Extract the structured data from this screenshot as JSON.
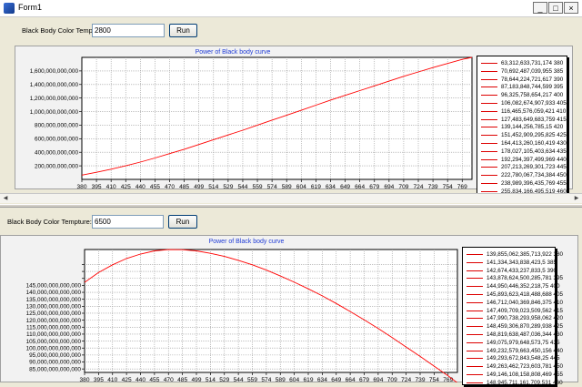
{
  "window": {
    "title": "Form1",
    "min_label": "_",
    "max_label": "□",
    "close_label": "×"
  },
  "icons": {
    "app": "app-icon",
    "minimize": "minimize-icon",
    "maximize": "maximize-icon",
    "close": "close-icon",
    "left": "arrow-left-icon",
    "right": "arrow-right-icon"
  },
  "colors": {
    "curve": "#ff0000",
    "title": "#1f3bd6",
    "grid": "#9a9a9a"
  },
  "panel1": {
    "label": "Black Body Color Tempture:",
    "input_value": "2800",
    "run_label": "Run",
    "chart_title": "Power of Black body curve",
    "legend": [
      "63,312,633,731,174 380",
      "70,692,487,039,955 385",
      "78,644,224,721,617 390",
      "87,183,848,744,599 395",
      "96,325,758,654,217 400",
      "106,082,674,907,933 405",
      "116,465,576,059,421 410",
      "127,483,649,683,759 415",
      "139,144,256,785,15 420",
      "151,452,909,295,825 425",
      "164,413,260,160,419 430",
      "178,027,105,403,634 435",
      "192,294,397,499,969 440",
      "207,213,269,301,723 445",
      "222,780,067,734,384 450",
      "238,989,396,435,769 455",
      "255,834,166,495,519 460"
    ]
  },
  "panel2": {
    "label": "Black Body Color Tempture:",
    "input_value": "6500",
    "run_label": "Run",
    "chart_title": "Power of Black body curve",
    "legend": [
      "139,855,062,385,713,922 380",
      "141,334,343,838,423,5 385",
      "142,674,433,237,833,5 390",
      "143,878,624,500,285,781 395",
      "144,950,446,352,218,75 400",
      "145,893,623,418,488,688 405",
      "146,712,040,369,846,375 410",
      "147,409,709,023,509,562 415",
      "147,990,738,293,958,062 420",
      "148,459,306,870,289,938 425",
      "148,819,638,487,036,344 430",
      "149,075,979,648,573,75 435",
      "149,232,579,663,450,156 440",
      "149,293,672,843,548,25 445",
      "149,263,462,723,603,781 450",
      "149,146,108,158,808,469 455",
      "148,945,711,161,709,531 460"
    ]
  },
  "chart_data": [
    {
      "type": "line",
      "title": "Power of Black body curve",
      "xlabel": "",
      "ylabel": "",
      "categories": [
        "380",
        "395",
        "410",
        "425",
        "440",
        "455",
        "470",
        "485",
        "499",
        "514",
        "529",
        "544",
        "559",
        "574",
        "589",
        "604",
        "619",
        "634",
        "649",
        "664",
        "679",
        "694",
        "709",
        "724",
        "739",
        "754",
        "769"
      ],
      "x": [
        380,
        395,
        410,
        425,
        440,
        455,
        470,
        485,
        500,
        515,
        530,
        545,
        560,
        575,
        590,
        605,
        620,
        635,
        650,
        665,
        680,
        695,
        710,
        725,
        740,
        755,
        770,
        780
      ],
      "values": [
        63000000000000,
        105000000000000,
        150000000000000,
        200000000000000,
        255000000000000,
        315000000000000,
        380000000000000,
        445000000000000,
        515000000000000,
        585000000000000,
        655000000000000,
        725000000000000,
        800000000000000,
        875000000000000,
        945000000000000,
        1020000000000000,
        1095000000000000,
        1170000000000000,
        1240000000000000,
        1310000000000000,
        1380000000000000,
        1450000000000000,
        1520000000000000,
        1585000000000000,
        1650000000000000,
        1710000000000000,
        1770000000000000,
        1805000000000000
      ],
      "xlim": [
        380,
        780
      ],
      "ylim": [
        0,
        1800000000000000
      ],
      "yticks": [
        200000000000000,
        400000000000000,
        600000000000000,
        800000000000000,
        1000000000000000,
        1200000000000000,
        1400000000000000,
        1600000000000000
      ],
      "ytick_labels": [
        "200,000,000,000",
        "400,000,000,000",
        "600,000,000,000",
        "800,000,000,000",
        "1,000,000,000,000",
        "1,200,000,000,000",
        "1,400,000,000,000",
        "1,600,000,000,000"
      ],
      "grid": true,
      "legend": "right"
    },
    {
      "type": "line",
      "title": "Power of Black body curve",
      "xlabel": "",
      "ylabel": "",
      "categories": [
        "380",
        "395",
        "410",
        "425",
        "440",
        "455",
        "470",
        "485",
        "499",
        "514",
        "529",
        "544",
        "559",
        "574",
        "589",
        "604",
        "619",
        "634",
        "649",
        "664",
        "679",
        "694",
        "709",
        "724",
        "739",
        "754",
        "769"
      ],
      "x": [
        380,
        395,
        410,
        425,
        440,
        455,
        470,
        485,
        500,
        515,
        530,
        545,
        560,
        575,
        590,
        605,
        620,
        635,
        650,
        665,
        680,
        695,
        710,
        725,
        740,
        755,
        770,
        780
      ],
      "values": [
        139855000000000000,
        142700000000000000,
        144900000000000000,
        146700000000000000,
        148000000000000000,
        148900000000000000,
        149270000000000000,
        149250000000000000,
        148900000000000000,
        148200000000000000,
        147300000000000000,
        146200000000000000,
        144900000000000000,
        143400000000000000,
        141700000000000000,
        139900000000000000,
        138000000000000000,
        136000000000000000,
        133800000000000000,
        131500000000000000,
        129100000000000000,
        126600000000000000,
        124000000000000000,
        121300000000000000,
        118600000000000000,
        115800000000000000,
        113000000000000000,
        111000000000000000
      ],
      "xlim": [
        380,
        780
      ],
      "ylim": [
        114000000000000000,
        149300000000000000
      ],
      "yticks": [
        115000000000000000,
        117000000000000000,
        119000000000000000,
        121000000000000000,
        123000000000000000,
        125000000000000000,
        127000000000000000,
        129000000000000000,
        131000000000000000,
        133000000000000000,
        135000000000000000,
        137000000000000000,
        139000000000000000,
        141000000000000000,
        143000000000000000,
        145000000000000000
      ],
      "ytick_labels": [
        "85,000,000,000,000",
        "90,000,000,000,000",
        "95,000,000,000,000",
        "100,000,000,000,000",
        "105,000,000,000,000",
        "110,000,000,000,000",
        "115,000,000,000,000",
        "120,000,000,000,000",
        "125,000,000,000,000",
        "130,000,000,000,000",
        "135,000,000,000,000",
        "140,000,000,000,000",
        "145,000,000,000,000"
      ],
      "grid": true,
      "legend": "right"
    }
  ]
}
